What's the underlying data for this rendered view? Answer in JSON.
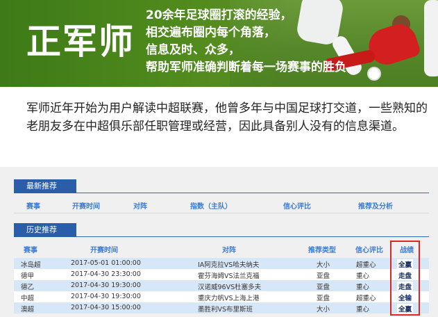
{
  "banner": {
    "title": "正军师",
    "lines": [
      "20余年足球圈打滚的经验，",
      "相交遍布圈内每个角落，",
      "信息及时、众多，",
      "帮助军师准确判断着每一场赛事的胜负。"
    ]
  },
  "intro": {
    "text": "军师近年开始为用户解读中超联赛，他曾多年与中国足球打交道，一些熟知的老朋友多在中超俱乐部任职管理或经营，因此具备别人没有的信息渠道。"
  },
  "latest": {
    "tab": "最新推荐",
    "headers": [
      "赛事",
      "开赛时间",
      "对阵",
      "指数（主队）",
      "信心评比",
      "推荐及分析"
    ]
  },
  "history": {
    "tab": "历史推荐",
    "headers": [
      "赛事",
      "开赛时间",
      "对阵",
      "推荐类型",
      "信心评比",
      "战绩"
    ],
    "rows": [
      {
        "league": "冰岛超",
        "time": "2017-05-01 01:00:00",
        "match": "IA阿克拉VS哈夫纳夫",
        "type": "大小",
        "conf": "超重心",
        "result": "全赢"
      },
      {
        "league": "德甲",
        "time": "2017-04-30 23:30:00",
        "match": "霍芬海姆VS法兰克福",
        "type": "亚盘",
        "conf": "重心",
        "result": "走盘"
      },
      {
        "league": "德乙",
        "time": "2017-04-30 19:30:00",
        "match": "汉诺威96VS杜塞多夫",
        "type": "亚盘",
        "conf": "重心",
        "result": "走盘"
      },
      {
        "league": "中超",
        "time": "2017-04-30 19:30:00",
        "match": "重庆力帆VS上海上港",
        "type": "亚盘",
        "conf": "超重心",
        "result": "全输"
      },
      {
        "league": "澳超",
        "time": "2017-04-30 15:00:00",
        "match": "墨胜利VS布里斯班",
        "type": "大小",
        "conf": "重心",
        "result": "全赢"
      }
    ]
  }
}
